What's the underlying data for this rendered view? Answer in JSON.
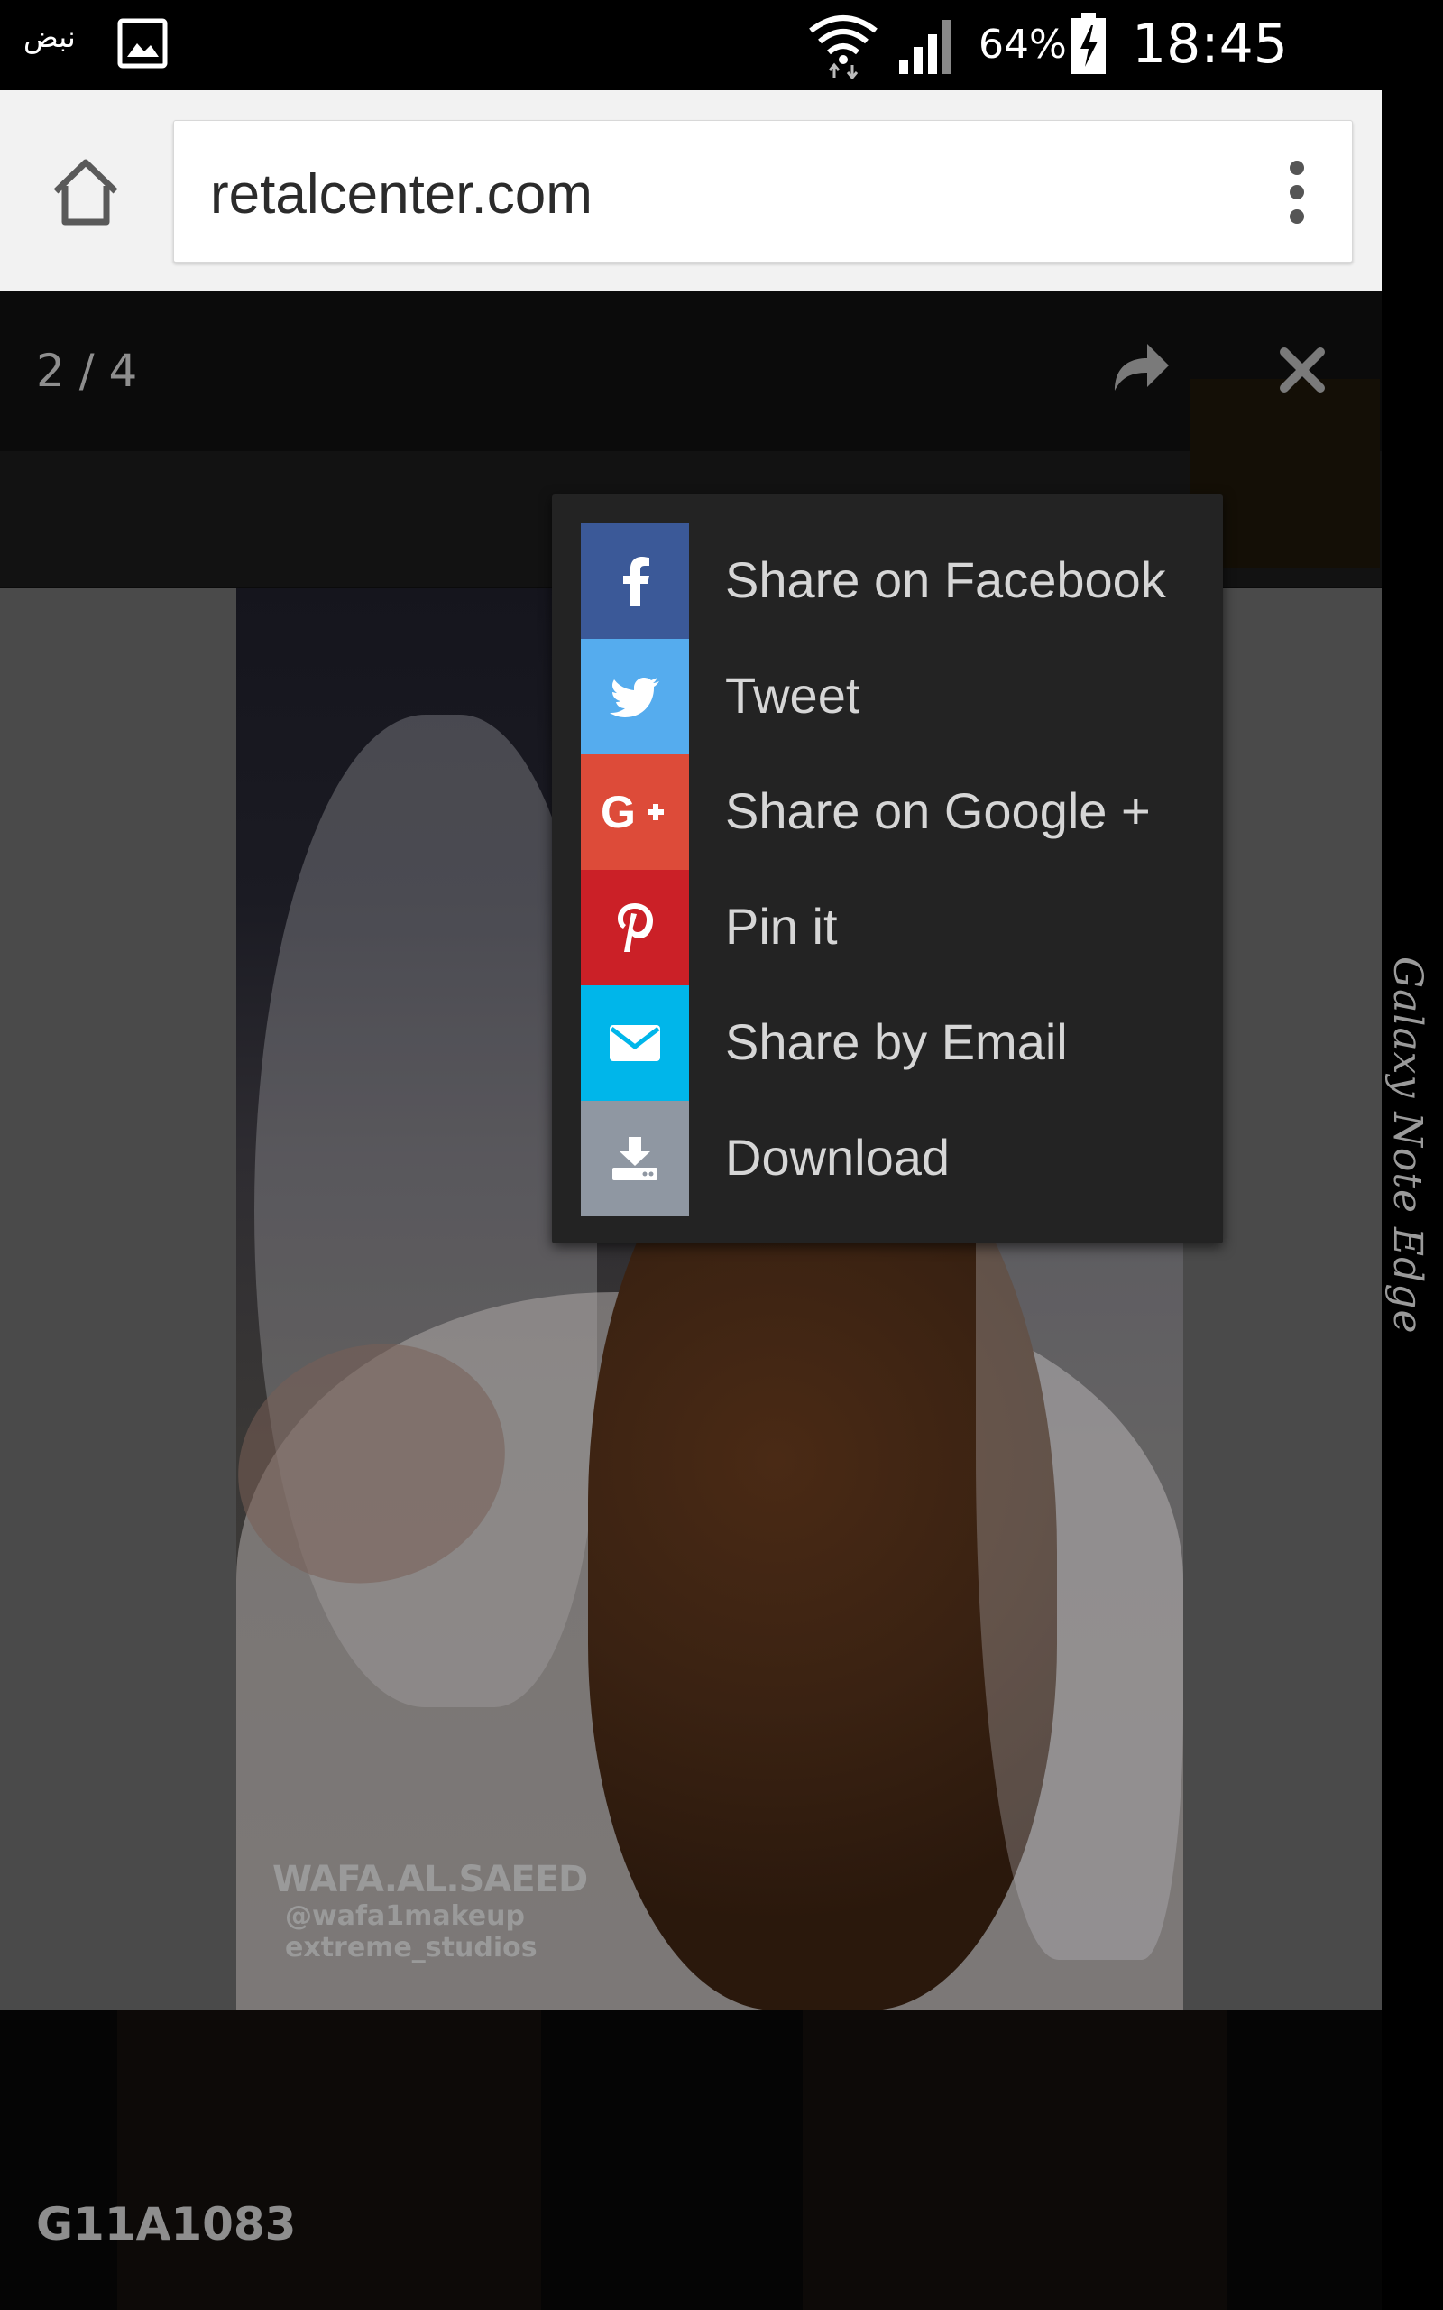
{
  "status_bar": {
    "carrier": "نبض",
    "battery": "64%",
    "time": "18:45"
  },
  "browser": {
    "url": "retalcenter.com"
  },
  "lightbox": {
    "counter": "2 / 4",
    "caption": "G11A1083",
    "watermark": {
      "line1": "WAFA.AL.SAEED",
      "line2": "@wafa1makeup",
      "line3": "extreme_studios"
    }
  },
  "share_menu": {
    "items": [
      {
        "label": "Share on Facebook",
        "icon": "facebook-icon",
        "color": "#3b5998"
      },
      {
        "label": "Tweet",
        "icon": "twitter-icon",
        "color": "#55acee"
      },
      {
        "label": "Share on Google +",
        "icon": "google-plus-icon",
        "color": "#dd4b39"
      },
      {
        "label": "Pin it",
        "icon": "pinterest-icon",
        "color": "#cb2027"
      },
      {
        "label": "Share by Email",
        "icon": "email-icon",
        "color": "#00b6ea"
      },
      {
        "label": "Download",
        "icon": "download-icon",
        "color": "#8f97a2"
      }
    ]
  },
  "device": {
    "edge_label": "Galaxy Note Edge"
  }
}
